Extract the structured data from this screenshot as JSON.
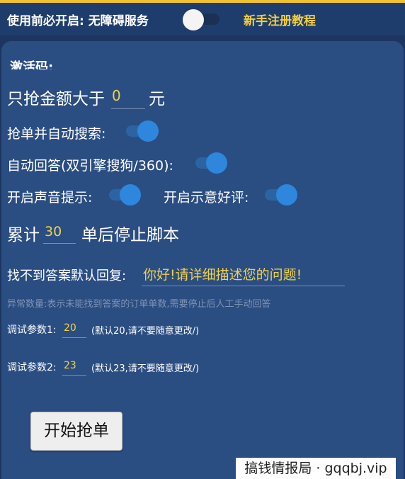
{
  "top_bar": {
    "label": "使用前必开启: 无障碍服务",
    "tutorial_link": "新手注册教程",
    "accessibility_toggle": "off"
  },
  "partial_header": "激活码:",
  "min_amount": {
    "prefix": "只抢金额大于",
    "value": "0",
    "suffix": "元"
  },
  "auto_search": {
    "label": "抢单并自动搜索:",
    "state": "on"
  },
  "auto_answer": {
    "label": "自动回答(双引擎搜狗/360):",
    "state": "on"
  },
  "sound_hint": {
    "label": "开启声音提示:",
    "state": "on"
  },
  "good_review": {
    "label": "开启示意好评:",
    "state": "on"
  },
  "stop_after": {
    "prefix": "累计",
    "value": "30",
    "suffix": "单后停止脚本"
  },
  "default_reply": {
    "label": "找不到答案默认回复:",
    "value": "你好!请详细描述您的问题!"
  },
  "abnormal_note": "异常数量:表示未能找到答案的订单单数,需要停止后人工手动回答",
  "debug1": {
    "label": "调试参数1:",
    "value": "20",
    "hint": "(默认20,请不要随意更改/)"
  },
  "debug2": {
    "label": "调试参数2:",
    "value": "23",
    "hint": "(默认23,请不要随意更改/)"
  },
  "start_button": "开始抢单",
  "watermark": "搞钱情报局 · gqqbj.vip",
  "colors": {
    "background": "#1d3560",
    "panel": "#2a4d82",
    "accent_text": "#f2d24b",
    "switch_on": "#2e86dd",
    "top_rule": "#f2c230"
  }
}
